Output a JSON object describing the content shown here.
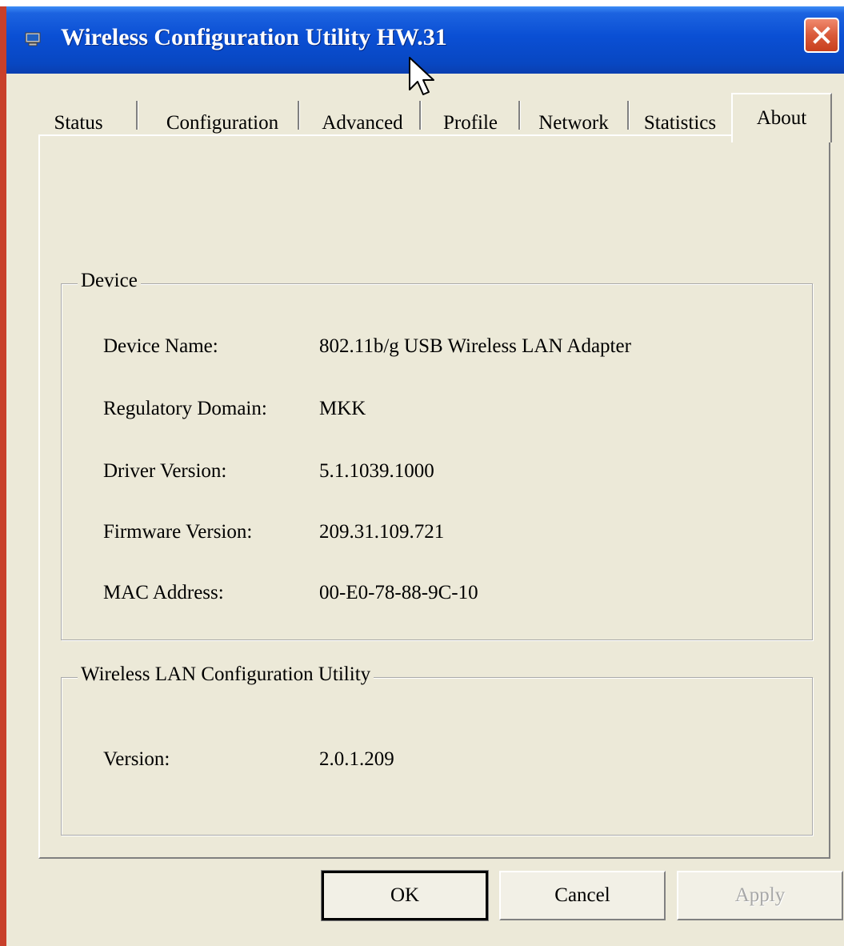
{
  "window": {
    "title": "Wireless Configuration Utility HW.31",
    "icon": "computer-icon"
  },
  "tabs": [
    {
      "label": "Status"
    },
    {
      "label": "Configuration"
    },
    {
      "label": "Advanced"
    },
    {
      "label": "Profile"
    },
    {
      "label": "Network"
    },
    {
      "label": "Statistics"
    },
    {
      "label": "About",
      "active": true
    }
  ],
  "device_group": {
    "title": "Device",
    "rows": [
      {
        "label": "Device Name:",
        "value": "802.11b/g USB Wireless LAN Adapter"
      },
      {
        "label": "Regulatory Domain:",
        "value": "MKK"
      },
      {
        "label": "Driver Version:",
        "value": "5.1.1039.1000"
      },
      {
        "label": "Firmware Version:",
        "value": "209.31.109.721"
      },
      {
        "label": "MAC Address:",
        "value": "00-E0-78-88-9C-10"
      }
    ]
  },
  "utility_group": {
    "title": "Wireless LAN Configuration Utility",
    "rows": [
      {
        "label": "Version:",
        "value": "2.0.1.209"
      }
    ]
  },
  "buttons": {
    "ok": "OK",
    "cancel": "Cancel",
    "apply": "Apply"
  },
  "colors": {
    "titlebar": "#0a4fd4",
    "face": "#ece9d8",
    "close": "#d95a3a"
  }
}
